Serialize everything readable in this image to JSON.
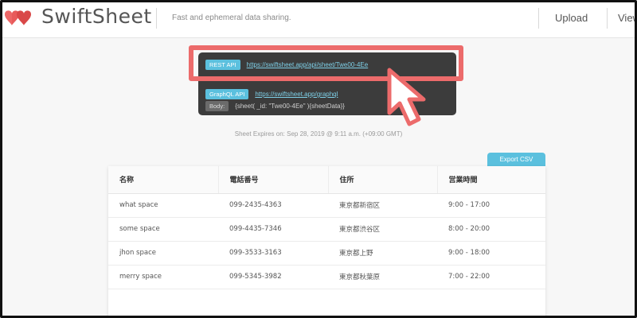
{
  "header": {
    "logo_text": "SwiftSheet",
    "tagline": "Fast and ephemeral data sharing.",
    "nav": {
      "upload": "Upload",
      "view": "View"
    }
  },
  "api": {
    "rest_badge": "REST API",
    "rest_url": "https://swiftsheet.app/api/sheet/Twe00-4Ee",
    "graphql_badge": "GraphQL API",
    "graphql_url": "https://swiftsheet.app/graphql",
    "body_badge": "Body:",
    "body_text": "{sheet( _id: \"Twe00-4Ee\" ){sheetData}}"
  },
  "expires_text": "Sheet Expires on: Sep 28, 2019 @ 9:11 a.m. (+09:00 GMT)",
  "export_label": "Export CSV",
  "table": {
    "headers": [
      "名称",
      "電話番号",
      "住所",
      "営業時間"
    ],
    "rows": [
      [
        "what space",
        "099-2435-4363",
        "東京都新宿区",
        "9:00 - 17:00"
      ],
      [
        "some space",
        "099-4435-7346",
        "東京都渋谷区",
        "8:00 - 20:00"
      ],
      [
        "jhon space",
        "099-3533-3163",
        "東京都上野",
        "9:00 - 18:00"
      ],
      [
        "merry space",
        "099-5345-3982",
        "東京都秋葉原",
        "7:00 - 22:00"
      ]
    ]
  },
  "colors": {
    "accent": "#5bc0de",
    "highlight": "#ec6b6b",
    "panel": "#3c3c3c",
    "logo_red": "#e85a5a"
  },
  "icons": {
    "logo": "double-heart-logo-icon",
    "cursor": "arrow-cursor-icon"
  }
}
